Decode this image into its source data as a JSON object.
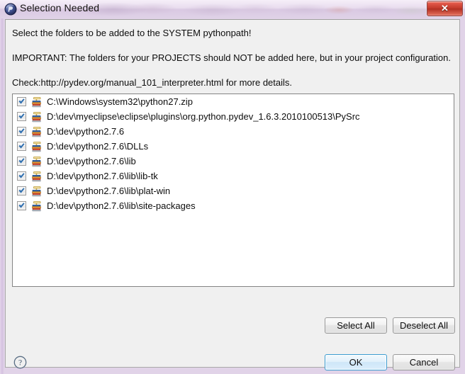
{
  "window": {
    "title": "Selection Needed",
    "icon": "pydev-icon",
    "close_label": "✕",
    "accent_blue": "#3c9cd0",
    "close_red": "#c23a2c",
    "titlebar_glass": "#e2d2ea",
    "dialog_bg": "#f0f0f0"
  },
  "messages": {
    "line1": "Select the folders to be added to the SYSTEM pythonpath!",
    "line2": "IMPORTANT: The folders for your PROJECTS should NOT be added here, but in your project configuration.",
    "line3": "Check:http://pydev.org/manual_101_interpreter.html for more details."
  },
  "list": {
    "items": [
      {
        "checked": true,
        "icon": "library-books-icon",
        "path": "C:\\Windows\\system32\\python27.zip"
      },
      {
        "checked": true,
        "icon": "library-books-icon",
        "path": "D:\\dev\\myeclipse\\eclipse\\plugins\\org.python.pydev_1.6.3.2010100513\\PySrc"
      },
      {
        "checked": true,
        "icon": "library-books-icon",
        "path": "D:\\dev\\python2.7.6"
      },
      {
        "checked": true,
        "icon": "library-books-icon",
        "path": "D:\\dev\\python2.7.6\\DLLs"
      },
      {
        "checked": true,
        "icon": "library-books-icon",
        "path": "D:\\dev\\python2.7.6\\lib"
      },
      {
        "checked": true,
        "icon": "library-books-icon",
        "path": "D:\\dev\\python2.7.6\\lib\\lib-tk"
      },
      {
        "checked": true,
        "icon": "library-books-icon",
        "path": "D:\\dev\\python2.7.6\\lib\\plat-win"
      },
      {
        "checked": true,
        "icon": "library-books-icon",
        "path": "D:\\dev\\python2.7.6\\lib\\site-packages"
      }
    ]
  },
  "buttons": {
    "select_all": "Select All",
    "deselect_all": "Deselect All",
    "ok": "OK",
    "cancel": "Cancel"
  },
  "help": {
    "icon": "question-mark-icon",
    "glyph": "?"
  }
}
